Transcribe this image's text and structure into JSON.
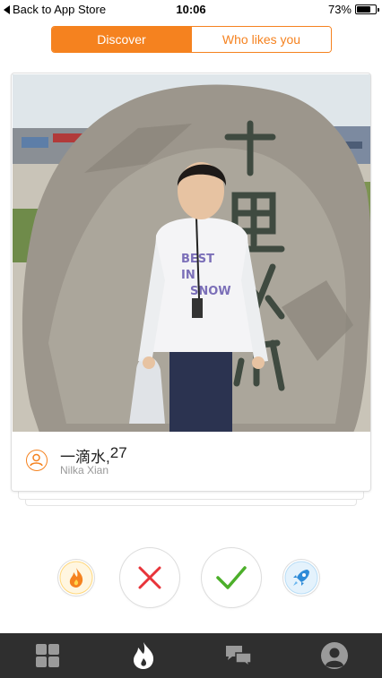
{
  "status_bar": {
    "back_label": "Back to App Store",
    "time": "10:06",
    "battery_percent": "73%",
    "battery_level": 0.73
  },
  "tabs": [
    {
      "label": "Discover",
      "active": true
    },
    {
      "label": "Who likes you",
      "active": false
    }
  ],
  "profile": {
    "name": "一滴水,",
    "age": "27",
    "subtitle": "Nilka Xian"
  },
  "actions": [
    {
      "name": "boost",
      "icon": "flame-icon"
    },
    {
      "name": "dislike",
      "icon": "close-icon"
    },
    {
      "name": "like",
      "icon": "check-icon"
    },
    {
      "name": "super-boost",
      "icon": "rocket-icon"
    }
  ],
  "nav": [
    {
      "name": "grid",
      "icon": "grid-icon"
    },
    {
      "name": "discover",
      "icon": "flame-icon"
    },
    {
      "name": "messages",
      "icon": "chat-icon"
    },
    {
      "name": "profile",
      "icon": "user-icon"
    }
  ],
  "colors": {
    "accent": "#f5821f",
    "dislike": "#e8343a",
    "like": "#4caf2a",
    "nav_bg": "#2f2f2f"
  }
}
